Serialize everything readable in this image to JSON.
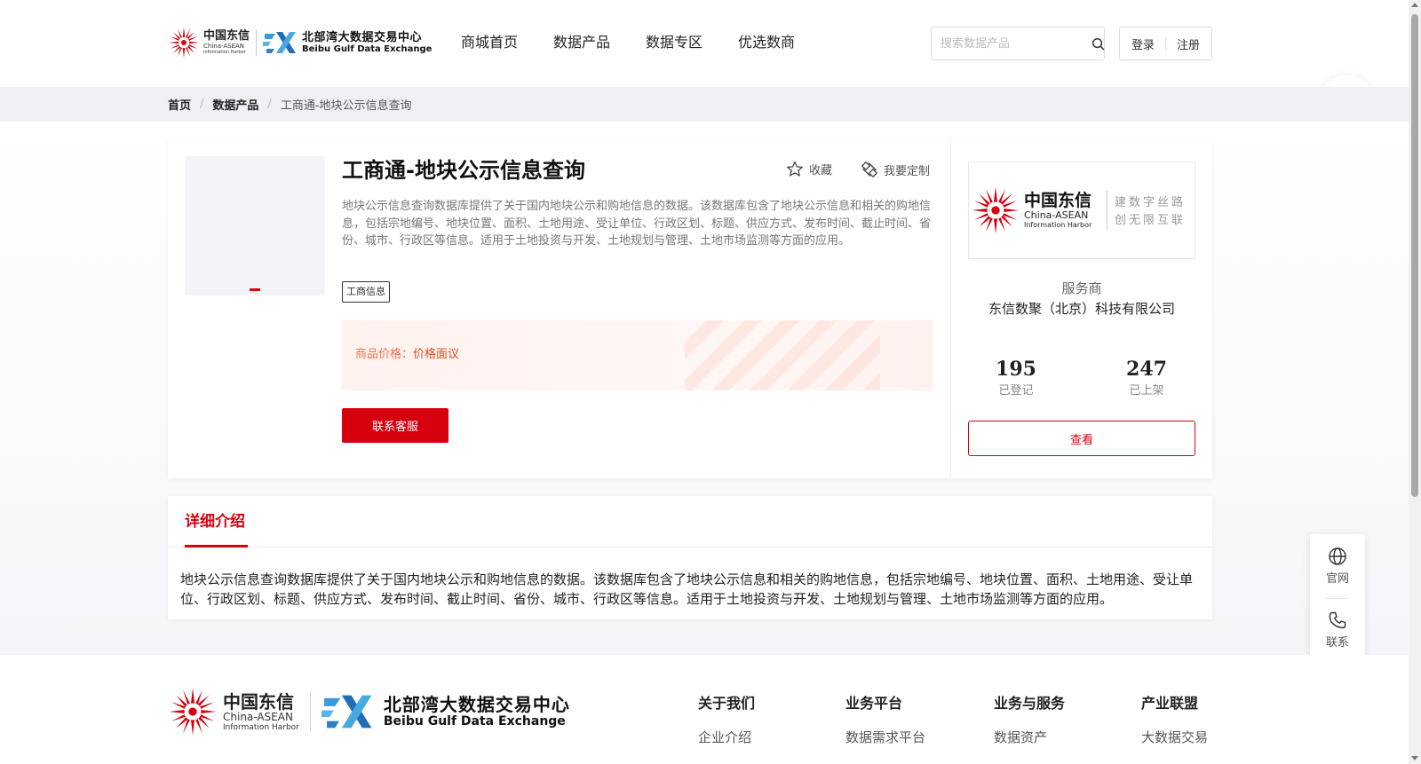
{
  "colors": {
    "brand_red": "#d7000f",
    "price_orange": "#f0704f",
    "text_dark": "#222222"
  },
  "header": {
    "logo_cdi": {
      "cn": "中国东信",
      "en1": "China-ASEAN",
      "en2": "Information Harbor"
    },
    "logo_bg": {
      "cn": "北部湾大数据交易中心",
      "en": "Beibu Gulf Data Exchange"
    },
    "nav": [
      "商城首页",
      "数据产品",
      "数据专区",
      "优选数商"
    ],
    "search_placeholder": "搜索数据产品",
    "login": "登录",
    "register": "注册"
  },
  "breadcrumb": {
    "home": "首页",
    "category": "数据产品",
    "current": "工商通-地块公示信息查询",
    "sep": "/"
  },
  "product": {
    "title": "工商通-地块公示信息查询",
    "favorite": "收藏",
    "customize": "我要定制",
    "description": "地块公示信息查询数据库提供了关于国内地块公示和购地信息的数据。该数据库包含了地块公示信息和相关的购地信息，包括宗地编号、地块位置、面积、土地用途、受让单位、行政区划、标题、供应方式、发布时间、截止时间、省份、城市、行政区等信息。适用于土地投资与开发、土地规划与管理、土地市场监测等方面的应用。",
    "tag": "工商信息",
    "price_label": "商品价格：",
    "price_value": "价格面议",
    "contact_button": "联系客服"
  },
  "vendor": {
    "logo": {
      "cn": "中国东信",
      "en1": "China-ASEAN",
      "en2": "Information Harbor",
      "slogan1": "建数字丝路",
      "slogan2": "创无限互联"
    },
    "role": "服务商",
    "name": "东信数聚（北京）科技有限公司",
    "registered_count": "195",
    "registered_label": "已登记",
    "listed_count": "247",
    "listed_label": "已上架",
    "view_button": "查看"
  },
  "detail": {
    "tab": "详细介绍",
    "text": "地块公示信息查询数据库提供了关于国内地块公示和购地信息的数据。该数据库包含了地块公示信息和相关的购地信息，包括宗地编号、地块位置、面积、土地用途、受让单位、行政区划、标题、供应方式、发布时间、截止时间、省份、城市、行政区等信息。适用于土地投资与开发、土地规划与管理、土地市场监测等方面的应用。"
  },
  "footer": {
    "logo_cdi": {
      "cn": "中国东信",
      "en1": "China-ASEAN",
      "en2": "Information Harbor"
    },
    "logo_bg": {
      "cn": "北部湾大数据交易中心",
      "en": "Beibu Gulf Data Exchange"
    },
    "columns": [
      {
        "title": "关于我们",
        "link": "企业介绍"
      },
      {
        "title": "业务平台",
        "link": "数据需求平台"
      },
      {
        "title": "业务与服务",
        "link": "数据资产"
      },
      {
        "title": "产业联盟",
        "link": "大数据交易"
      }
    ]
  },
  "side_widget": {
    "website": "官网",
    "contact": "联系"
  },
  "icons": [
    "search-icon",
    "star-icon",
    "customize-icon",
    "globe-icon",
    "phone-icon",
    "ai-assistant-icon",
    "starburst-logo-icon"
  ]
}
